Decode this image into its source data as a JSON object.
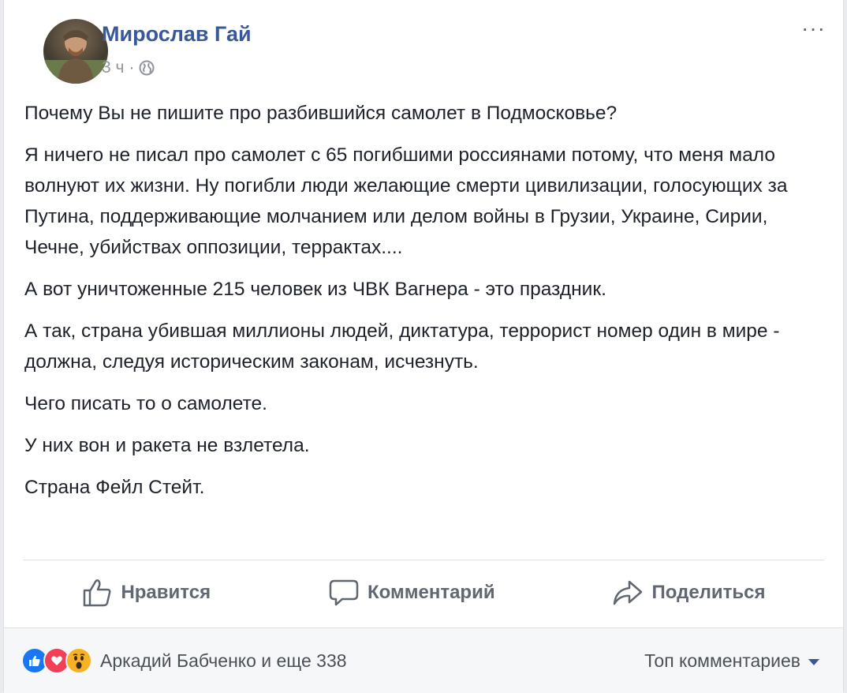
{
  "post": {
    "author": "Мирослав Гай",
    "time": "3 ч",
    "time_separator": "·",
    "more_label": "···",
    "paragraphs": [
      "Почему Вы не пишите про разбившийся самолет в Подмосковье?",
      "Я ничего не писал про самолет с 65 погибшими россиянами потому, что меня мало волнуют их жизни. Ну погибли люди желающие смерти цивилизации, голосующих за Путина, поддерживающие молчанием или делом войны в Грузии, Украине, Сирии, Чечне, убийствах оппозиции, террактах....",
      "А вот уничтоженные 215 человек из ЧВК Вагнера - это праздник.",
      "А так, страна убившая миллионы людей, диктатура, террорист номер один в мире - должна, следуя историческим законам, исчезнуть.",
      "Чего писать то о самолете.",
      "У них вон и ракета не взлетела.",
      "Страна Фейл Стейт."
    ]
  },
  "actions": {
    "like": "Нравится",
    "comment": "Комментарий",
    "share": "Поделиться"
  },
  "footer": {
    "reactors": "Аркадий Бабченко и еще 338",
    "sort": "Топ комментариев"
  },
  "colors": {
    "link": "#385898",
    "like_reaction": "#1877f2",
    "love_reaction": "#f33e58",
    "wow_reaction": "#f7b125"
  }
}
